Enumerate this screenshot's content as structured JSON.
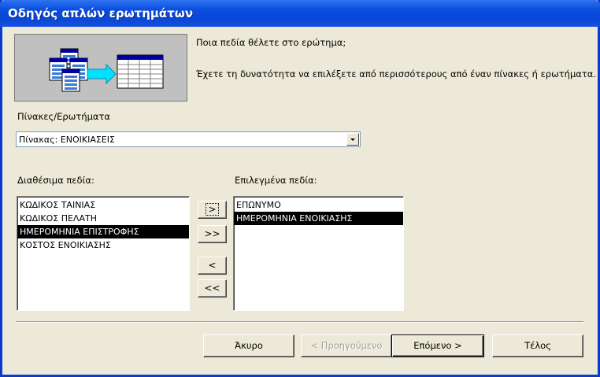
{
  "window": {
    "title": "Οδηγός απλών ερωτημάτων"
  },
  "intro": {
    "question": "Ποια πεδία θέλετε στο ερώτημα;",
    "hint": "Έχετε τη δυνατότητα να επιλέξετε από περισσότερους από έναν πίνακες ή ερωτήματα."
  },
  "tables_label": "Πίνακες/Ερωτήματα",
  "table_combo": {
    "value": "Πίνακας: ΕΝΟΙΚΙΑΣΕΙΣ"
  },
  "available": {
    "label": "Διαθέσιμα πεδία:",
    "items": [
      "ΚΩΔΙΚΟΣ ΤΑΙΝΙΑΣ",
      "ΚΩΔΙΚΟΣ ΠΕΛΑΤΗ",
      "ΗΜΕΡΟΜΗΝΙΑ ΕΠΙΣΤΡΟΦΗΣ",
      "ΚΟΣΤΟΣ ΕΝΟΙΚΙΑΣΗΣ"
    ],
    "selected_index": 2
  },
  "selected": {
    "label": "Επιλεγμένα πεδία:",
    "items": [
      "ΕΠΩΝΥΜΟ",
      "ΗΜΕΡΟΜΗΝΙΑ ΕΝΟΙΚΙΑΣΗΣ"
    ],
    "selected_index": 1
  },
  "move_buttons": {
    "add_one": ">",
    "add_all": ">>",
    "remove_one": "<",
    "remove_all": "<<"
  },
  "footer": {
    "cancel": "Άκυρο",
    "back": "< Προηγούμενο",
    "next": "Επόμενο >",
    "finish": "Τέλος"
  },
  "colors": {
    "title_bar": "#0a4fe0",
    "dialog_bg": "#ece9d8",
    "selection": "#000000"
  }
}
